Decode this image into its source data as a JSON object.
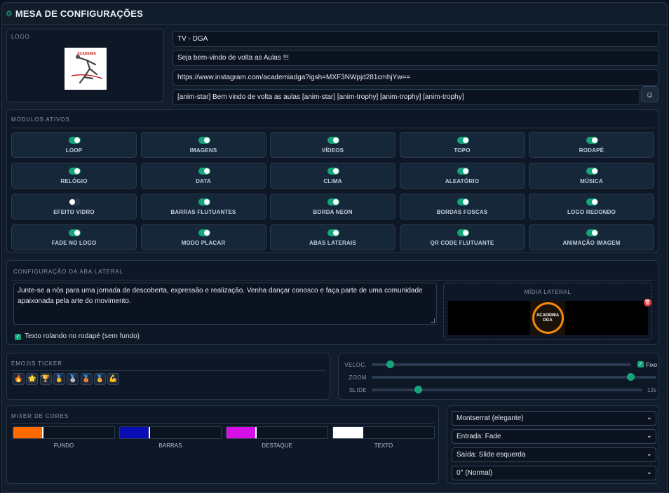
{
  "header": {
    "icon": "gear-icon",
    "title": "MESA DE CONFIGURAÇÕES"
  },
  "logo": {
    "label": "LOGO"
  },
  "inputs": {
    "name": "TV - DGA",
    "welcome": "Seja bem-vindo de volta as Aulas !!!",
    "url": "https://www.instagram.com/academiadga?igsh=MXF3NWpjd281cmhjYw==",
    "ticker": "[anim-star] Bem vindo de volta as aulas [anim-star] [anim-trophy] [anim-trophy] [anim-trophy]"
  },
  "emoji_button": {
    "icon": "☺"
  },
  "modules": {
    "label": "MÓDULOS ATIVOS",
    "items": [
      {
        "label": "LOOP",
        "on": true
      },
      {
        "label": "IMAGENS",
        "on": true
      },
      {
        "label": "VÍDEOS",
        "on": true
      },
      {
        "label": "TOPO",
        "on": true
      },
      {
        "label": "RODAPÉ",
        "on": true
      },
      {
        "label": "RELÓGIO",
        "on": true
      },
      {
        "label": "DATA",
        "on": true
      },
      {
        "label": "CLIMA",
        "on": true
      },
      {
        "label": "ALEATÓRIO",
        "on": true
      },
      {
        "label": "MÚSICA",
        "on": true
      },
      {
        "label": "EFEITO VIDRO",
        "on": false
      },
      {
        "label": "BARRAS FLUTUANTES",
        "on": true
      },
      {
        "label": "BORDA NEON",
        "on": true
      },
      {
        "label": "BORDAS FOSCAS",
        "on": true
      },
      {
        "label": "LOGO REDONDO",
        "on": true
      },
      {
        "label": "FADE NO LOGO",
        "on": true
      },
      {
        "label": "MODO PLACAR",
        "on": true
      },
      {
        "label": "ABAS LATERAIS",
        "on": true
      },
      {
        "label": "QR CODE FLUTUANTE",
        "on": true
      },
      {
        "label": "ANIMAÇÃO IMAGEM",
        "on": true
      }
    ]
  },
  "aba": {
    "label": "CONFIGURAÇÃO DA ABA LATERAL",
    "text": "Junte-se a nós para uma jornada de descoberta, expressão e realização. Venha dançar conosco e faça parte de uma comunidade apaixonada pela arte do movimento.",
    "footer_checkbox": "Texto rolando no rodapé (sem fundo)",
    "footer_checked": true,
    "media_label": "MÍDIA LATERAL",
    "media_caption": "ACADEMIA DGA"
  },
  "emojis": {
    "label": "EMOJIS TICKER",
    "items": [
      "🔥",
      "🌟",
      "🏆",
      "🥇",
      "🥈",
      "🥉",
      "🏅",
      "💪"
    ]
  },
  "sliders": {
    "speed": {
      "label": "VELOC.",
      "value": 0.07,
      "fixed_label": "Fixo",
      "fixed": true
    },
    "zoom": {
      "label": "ZOOM",
      "value": 0.91
    },
    "slide": {
      "label": "SLIDE",
      "value": 0.17,
      "value_text": "12s"
    }
  },
  "mixer": {
    "label": "MIXER DE CORES",
    "items": [
      {
        "label": "FUNDO",
        "color": "#ff6a00"
      },
      {
        "label": "BARRAS",
        "color": "#0a0db4"
      },
      {
        "label": "DESTAQUE",
        "color": "#d60fe6"
      },
      {
        "label": "TEXTO",
        "color": "#ffffff"
      }
    ]
  },
  "selects": {
    "font": "Montserrat (elegante)",
    "entrada": "Entrada: Fade",
    "saida": "Saída: Slide esquerda",
    "rotation": "0° (Normal)"
  }
}
